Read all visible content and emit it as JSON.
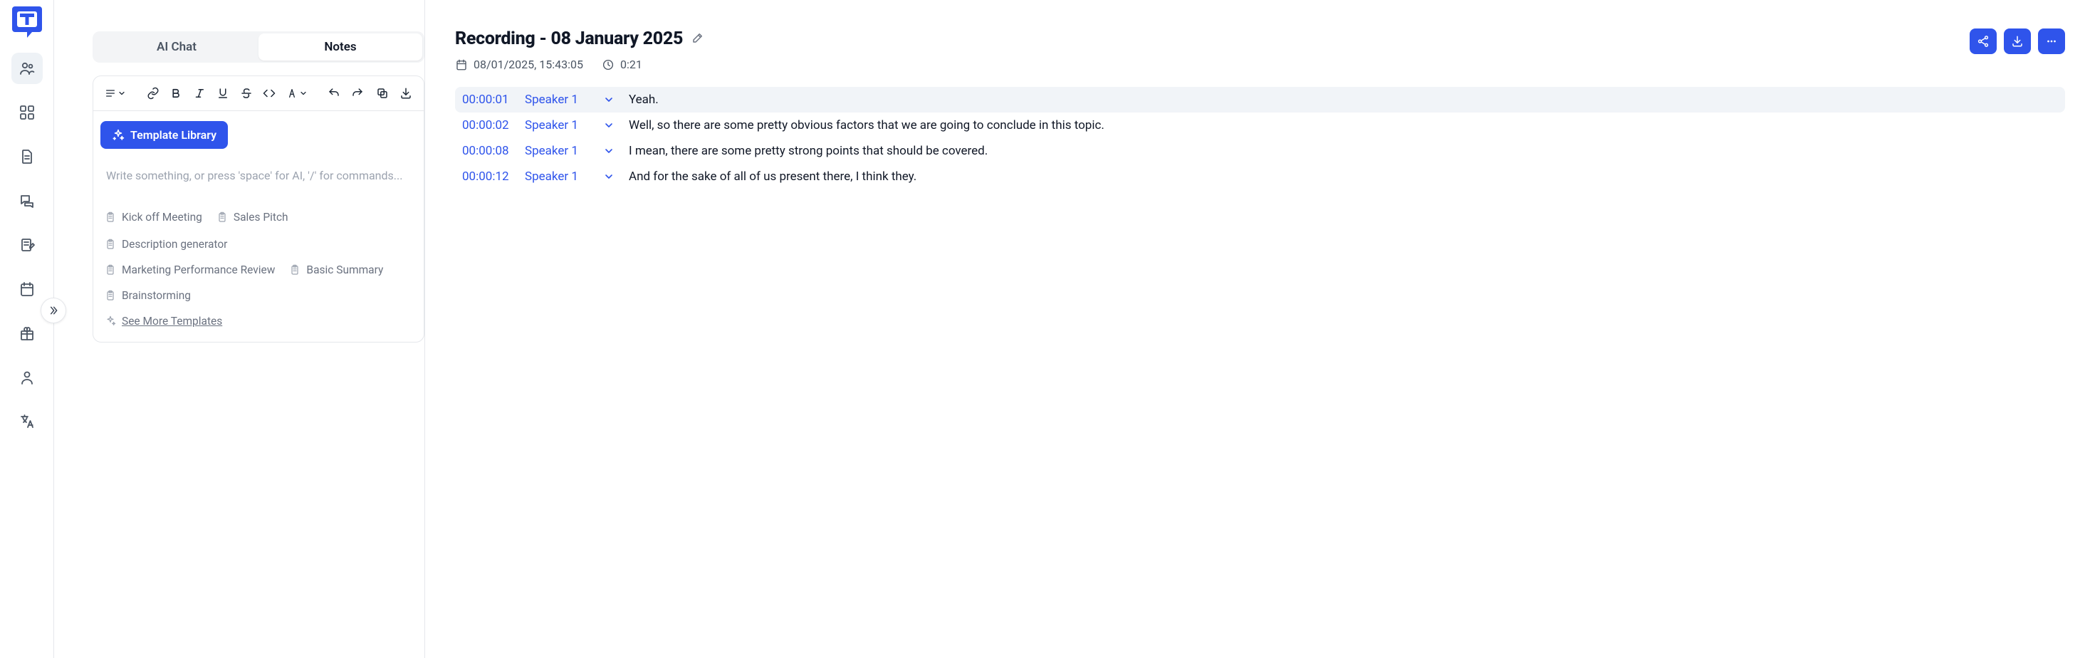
{
  "sidebar": {
    "items": [
      "team",
      "apps",
      "document",
      "chat",
      "note-edit",
      "calendar",
      "gift",
      "profile",
      "language"
    ]
  },
  "tabs": {
    "ai_chat": "AI Chat",
    "notes": "Notes"
  },
  "editor": {
    "template_library_label": "Template Library",
    "placeholder": "Write something, or press 'space' for AI, '/' for commands...",
    "templates": {
      "kickoff": "Kick off Meeting",
      "sales": "Sales Pitch",
      "descgen": "Description generator",
      "marketing": "Marketing Performance Review",
      "summary": "Basic Summary",
      "brainstorm": "Brainstorming"
    },
    "see_more": "See More Templates"
  },
  "recording": {
    "title": "Recording - 08 January 2025",
    "datetime": "08/01/2025, 15:43:05",
    "duration": "0:21"
  },
  "transcript": [
    {
      "time": "00:00:01",
      "speaker": "Speaker 1",
      "text": "Yeah.",
      "active": true
    },
    {
      "time": "00:00:02",
      "speaker": "Speaker 1",
      "text": "Well, so there are some pretty obvious factors that we are going to conclude in this topic.",
      "active": false
    },
    {
      "time": "00:00:08",
      "speaker": "Speaker 1",
      "text": "I mean, there are some pretty strong points that should be covered.",
      "active": false
    },
    {
      "time": "00:00:12",
      "speaker": "Speaker 1",
      "text": "And for the sake of all of us present there, I think they.",
      "active": false
    }
  ]
}
